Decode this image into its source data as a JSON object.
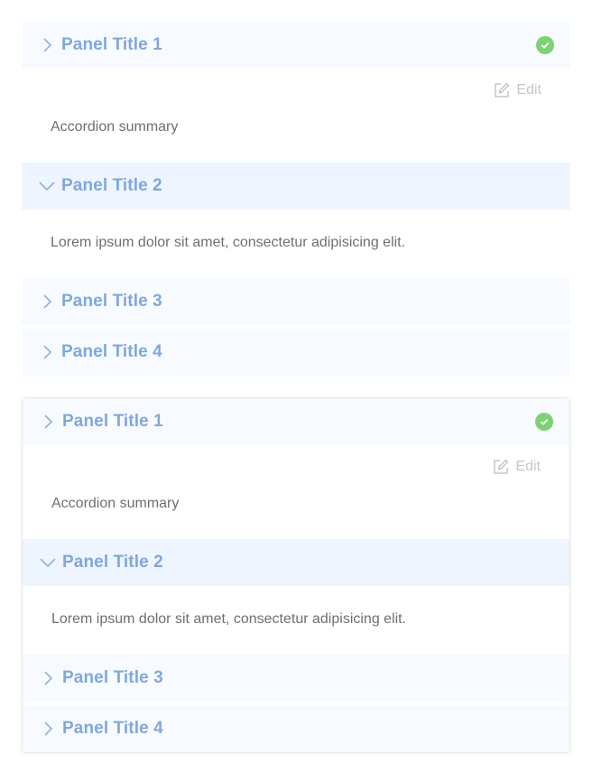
{
  "accordions": [
    {
      "panels": [
        {
          "title": "Panel Title 1",
          "status": "check-icon",
          "expanded": true,
          "edit_label": "Edit",
          "body": "Accordion summary"
        },
        {
          "title": "Panel Title 2",
          "status": "blue-dot",
          "expanded": true,
          "body": "Lorem ipsum dolor sit amet, consectetur adipisicing elit."
        },
        {
          "title": "Panel Title 3",
          "status": "gray-dot",
          "expanded": false
        },
        {
          "title": "Panel Title 4",
          "status": "none",
          "expanded": false
        }
      ]
    },
    {
      "panels": [
        {
          "title": "Panel Title 1",
          "status": "check-icon",
          "expanded": true,
          "edit_label": "Edit",
          "body": "Accordion summary"
        },
        {
          "title": "Panel Title 2",
          "status": "blue-dot",
          "expanded": true,
          "body": "Lorem ipsum dolor sit amet, consectetur adipisicing elit."
        },
        {
          "title": "Panel Title 3",
          "status": "gray-dot",
          "expanded": false
        },
        {
          "title": "Panel Title 4",
          "status": "none",
          "expanded": false
        }
      ]
    }
  ],
  "colors": {
    "title": "#7fa7e0",
    "header_bg": "#f7fbff",
    "header_open_bg": "#eef5fe",
    "success": "#7cd274",
    "active_dot": "#8fb9f3",
    "inactive_dot": "#c6c9ce"
  }
}
